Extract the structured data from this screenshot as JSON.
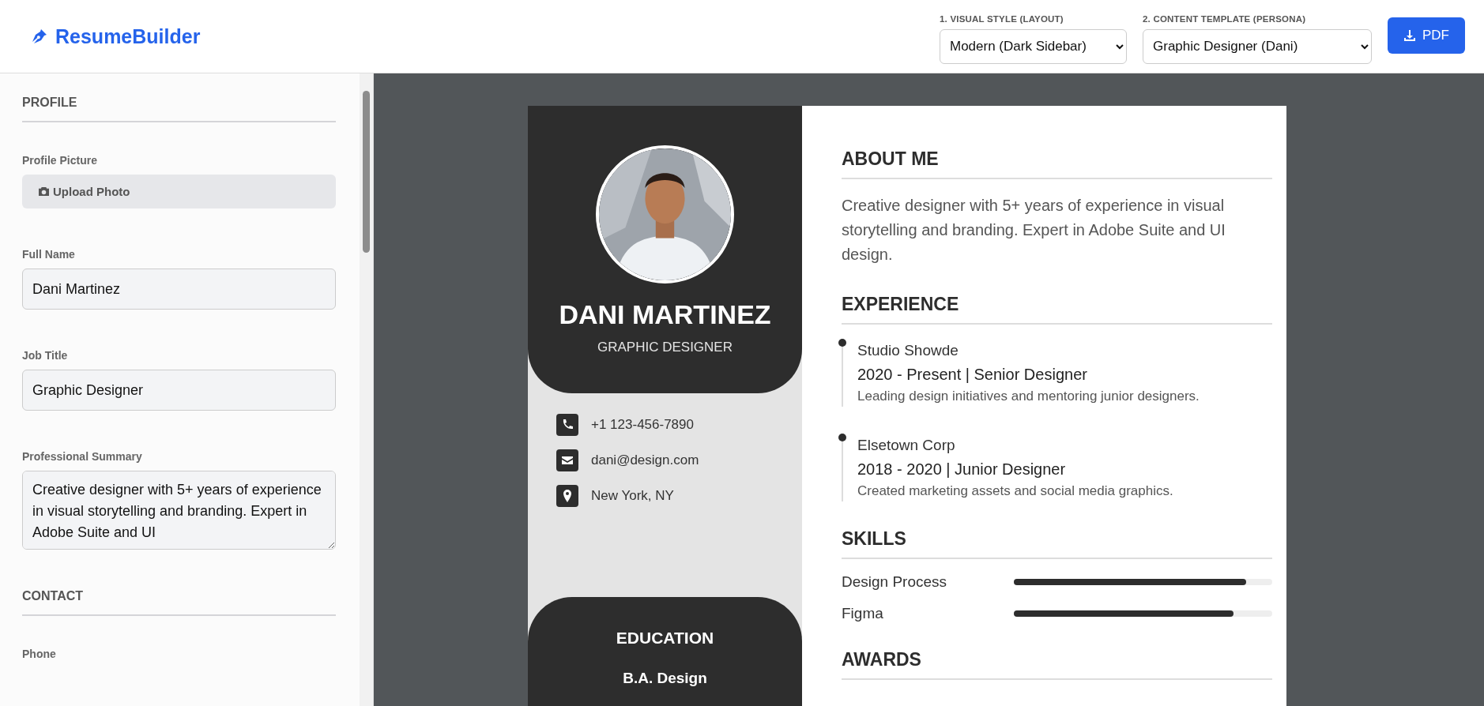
{
  "header": {
    "brand": "ResumeBuilder",
    "controls": [
      {
        "label": "1. VISUAL STYLE (LAYOUT)",
        "value": "Modern (Dark Sidebar)"
      },
      {
        "label": "2. CONTENT TEMPLATE (PERSONA)",
        "value": "Graphic Designer (Dani)"
      }
    ],
    "pdf_button": "PDF"
  },
  "editor": {
    "sections": [
      {
        "title": "PROFILE",
        "fields": [
          {
            "label": "Profile Picture",
            "kind": "upload",
            "value": "Upload Photo"
          },
          {
            "label": "Full Name",
            "kind": "text",
            "value": "Dani Martinez"
          },
          {
            "label": "Job Title",
            "kind": "text",
            "value": "Graphic Designer"
          },
          {
            "label": "Professional Summary",
            "kind": "textarea",
            "value": "Creative designer with 5+ years of experience in visual storytelling and branding. Expert in Adobe Suite and UI"
          }
        ]
      },
      {
        "title": "CONTACT",
        "fields": [
          {
            "label": "Phone"
          }
        ]
      }
    ]
  },
  "resume": {
    "name": "DANI MARTINEZ",
    "title": "GRAPHIC DESIGNER",
    "contacts": [
      {
        "kind": "phone",
        "text": "+1 123-456-7890"
      },
      {
        "kind": "email",
        "text": "dani@design.com"
      },
      {
        "kind": "location",
        "text": "New York, NY"
      }
    ],
    "education": {
      "heading": "EDUCATION",
      "items": [
        "B.A. Design"
      ]
    },
    "sections": [
      {
        "kind": "text",
        "heading": "ABOUT ME",
        "text": "Creative designer with 5+ years of experience in visual storytelling and branding. Expert in Adobe Suite and UI design."
      },
      {
        "kind": "timeline",
        "heading": "EXPERIENCE",
        "items": [
          {
            "company": "Studio Showde",
            "period": "2020 - Present | Senior Designer",
            "description": "Leading design initiatives and mentoring junior designers."
          },
          {
            "company": "Elsetown Corp",
            "period": "2018 - 2020 | Junior Designer",
            "description": "Created marketing assets and social media graphics."
          }
        ]
      },
      {
        "kind": "skills",
        "heading": "SKILLS",
        "items": [
          {
            "name": "Design Process",
            "level": 0.9
          },
          {
            "name": "Figma",
            "level": 0.85
          }
        ]
      },
      {
        "kind": "text",
        "heading": "AWARDS"
      }
    ]
  }
}
